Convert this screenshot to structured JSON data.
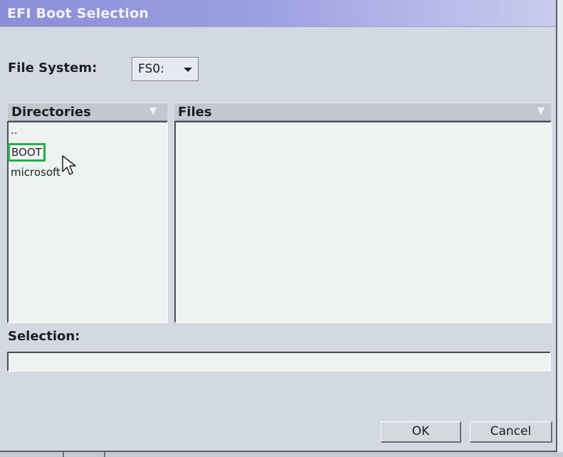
{
  "window": {
    "title": "EFI Boot Selection"
  },
  "file_system": {
    "label": "File System:",
    "value": "FS0:",
    "icon": "chevron-down-icon"
  },
  "directories": {
    "header": "Directories",
    "sort_icon": "sort-arrow-icon",
    "items": [
      {
        "label": "..",
        "selected": false
      },
      {
        "label": "BOOT",
        "selected": true
      },
      {
        "label": "microsoft",
        "selected": false
      }
    ]
  },
  "files": {
    "header": "Files",
    "sort_icon": "sort-arrow-icon",
    "items": []
  },
  "selection": {
    "label": "Selection:",
    "value": ""
  },
  "buttons": {
    "ok": "OK",
    "cancel": "Cancel"
  },
  "colors": {
    "titlebar": "#8c8fd8",
    "highlight": "#1fb24a",
    "dialog_bg": "#d3d9e3"
  }
}
